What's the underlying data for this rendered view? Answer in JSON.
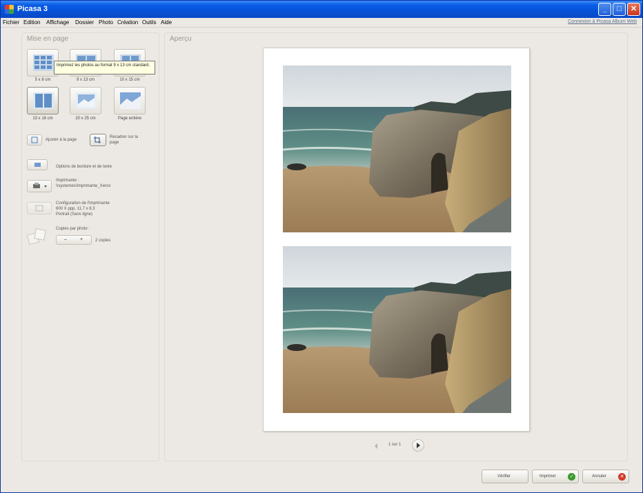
{
  "window": {
    "title": "Picasa 3",
    "minimize": "_",
    "maximize": "□",
    "close": "✕"
  },
  "menu": {
    "items": [
      "Fichier",
      "Edition",
      "Affichage",
      "Dossier",
      "Photo",
      "Création",
      "Outils",
      "Aide"
    ],
    "account_link": "Connexion à Picasa Album Web"
  },
  "left_panel": {
    "title": "Mise en page",
    "layouts": [
      {
        "label": "5 x 8 cm",
        "icon": "grid-4x3-layout-icon"
      },
      {
        "label": "9 x 13 cm",
        "icon": "grid-2x2-layout-icon"
      },
      {
        "label": "10 x 15 cm",
        "icon": "grid-2x2-layout-icon"
      },
      {
        "label": "13 x 18 cm",
        "icon": "two-up-layout-icon"
      },
      {
        "label": "20 x 25 cm",
        "icon": "single-photo-layout-icon"
      },
      {
        "label": "Page entière",
        "icon": "full-page-layout-icon"
      }
    ],
    "tooltip": "Imprimez les photos au format 9 x 13 cm standard.",
    "fit_option": "Ajuster à la page",
    "crop_option": "Recadrer sur la page",
    "border_text": "Options de bordure et de texte",
    "printer_label": "Imprimante :",
    "printer_name": "\\\\systemes\\Imprimante_Xerox",
    "printer_setup_label": "Configuration de l'imprimante",
    "printer_setup_line1": "600 X ppp, 11.7 x 8.3",
    "printer_setup_line2": "Portrait (Sans ligne)",
    "copies_label": "Copies par photo :",
    "copies_minus": "–",
    "copies_plus": "+",
    "copies_value": "2 copies"
  },
  "preview": {
    "title": "Aperçu",
    "pager": "1 sur 1"
  },
  "buttons": {
    "review": "Vérifier",
    "print": "Imprimer",
    "cancel": "Annuler"
  },
  "colors": {
    "titlebar": "#0652d8",
    "ok_green": "#3a9b2c",
    "cancel_red": "#d13a2a"
  }
}
